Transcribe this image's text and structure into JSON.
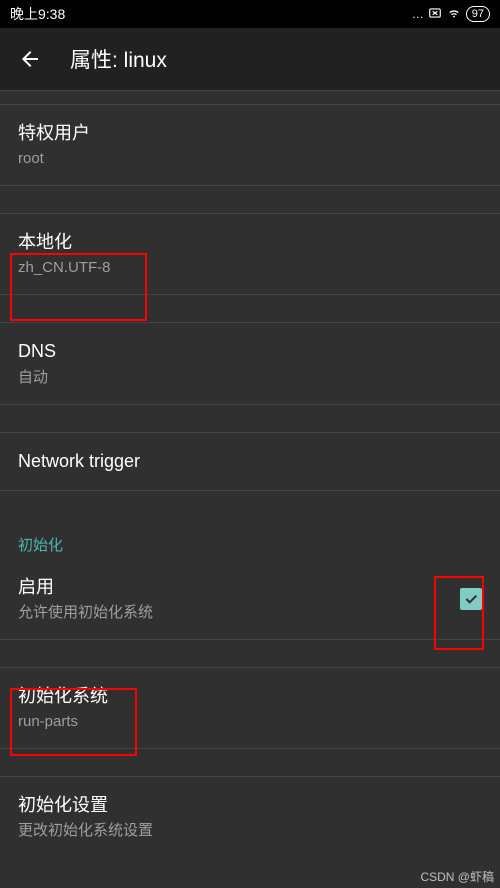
{
  "statusBar": {
    "time": "晚上9:38",
    "dots": "…",
    "xIcon": "⊗",
    "wifiIcon": "wifi",
    "batteryText": "97"
  },
  "appBar": {
    "title": "属性: linux"
  },
  "settings": {
    "privilegedUser": {
      "title": "特权用户",
      "value": "root"
    },
    "localization": {
      "title": "本地化",
      "value": "zh_CN.UTF-8"
    },
    "dns": {
      "title": "DNS",
      "value": "自动"
    },
    "networkTrigger": {
      "title": "Network trigger"
    },
    "initSection": "初始化",
    "enable": {
      "title": "启用",
      "subtitle": "允许使用初始化系统",
      "checked": true
    },
    "initSystem": {
      "title": "初始化系统",
      "value": "run-parts"
    },
    "initSettings": {
      "title": "初始化设置",
      "subtitle": "更改初始化系统设置"
    }
  },
  "watermark": "CSDN @虾稿"
}
